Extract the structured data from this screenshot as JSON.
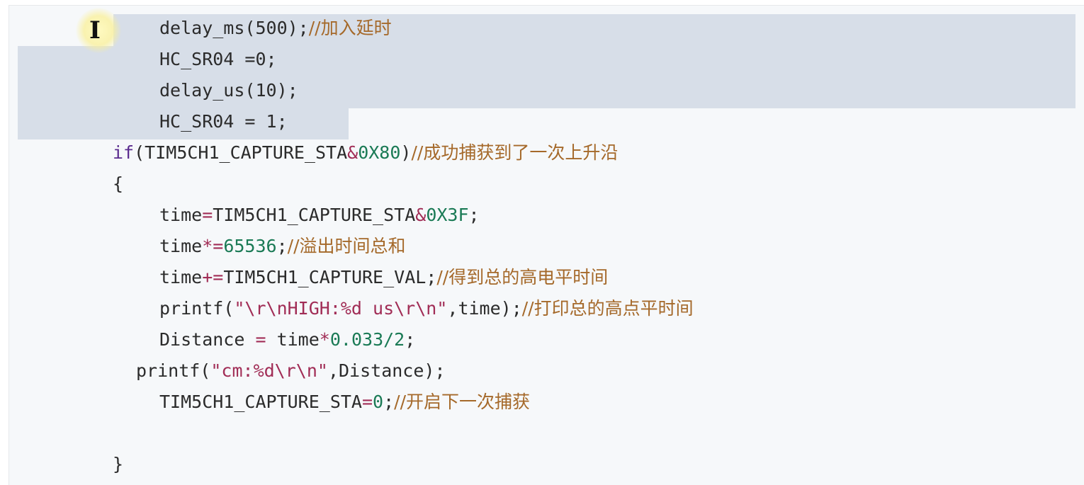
{
  "code_view": {
    "lines": {
      "l01": {
        "text": "delay_ms(500);",
        "comment": "//加入延时"
      },
      "l02": {
        "text": "HC_SR04 =0;"
      },
      "l03": {
        "text": "delay_us(10);"
      },
      "l04": {
        "text": "HC_SR04 = 1;"
      },
      "l05": {
        "kw": "if",
        "p1": "(TIM5CH1_CAPTURE_STA",
        "op": "&",
        "num": "0X80",
        "p2": ")",
        "comment": "//成功捕获到了一次上升沿"
      },
      "l06": {
        "text": "{"
      },
      "l07": {
        "p1": "time",
        "op1": "=",
        "p2": "TIM5CH1_CAPTURE_STA",
        "op2": "&",
        "num": "0X3F",
        "p3": ";"
      },
      "l08": {
        "p1": "time",
        "op": "*=",
        "num": "65536",
        "p2": ";",
        "comment": "//溢出时间总和"
      },
      "l09": {
        "p1": "time",
        "op": "+=",
        "p2": "TIM5CH1_CAPTURE_VAL;",
        "comment": "//得到总的高电平时间"
      },
      "l10": {
        "p1": "printf(",
        "str": "\"\\r\\nHIGH:%d us\\r\\n\"",
        "p2": ",time);",
        "comment": "//打印总的高点平时间"
      },
      "l11": {
        "p1": "Distance ",
        "op1": "=",
        "p2": " time",
        "op2": "*",
        "num": "0.033/2",
        "p3": ";"
      },
      "l12": {
        "p1": "printf(",
        "str": "\"cm:%d\\r\\n\"",
        "p2": ",Distance);"
      },
      "l13": {
        "p1": "TIM5CH1_CAPTURE_STA",
        "op": "=",
        "num": "0",
        "p2": ";",
        "comment": "//开启下一次捕获"
      },
      "l14": {
        "text": "}"
      }
    },
    "colors": {
      "background": "#f6f8fa",
      "selection": "#d7dee8",
      "text": "#2b2b2b",
      "keyword": "#5b2c8f",
      "operator": "#a12d56",
      "number": "#1a7a55",
      "string": "#a12d56",
      "comment": "#a5692a"
    },
    "cursor": {
      "icon": "text-cursor-icon",
      "glyph": "I"
    }
  }
}
